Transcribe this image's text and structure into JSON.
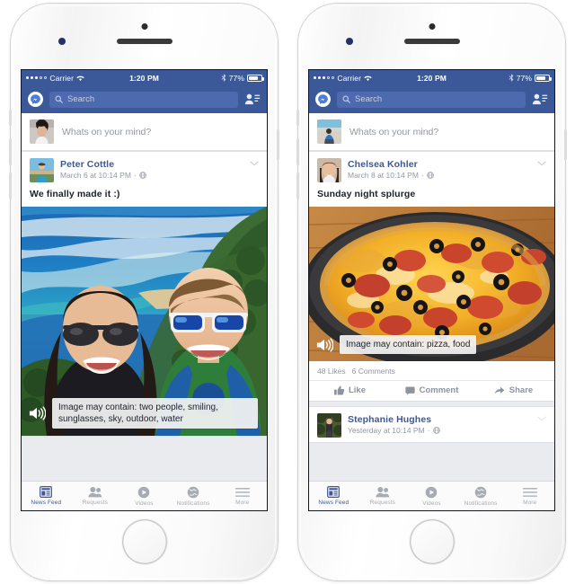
{
  "theme": {
    "brand_blue": "#3b5998",
    "search_field": "#4c6aad",
    "feed_background": "#e9ebee",
    "card_background": "#ffffff",
    "muted_text": "#9097a3",
    "body_text": "#1d2129"
  },
  "status_bar": {
    "carrier": "Carrier",
    "wifi_icon": "wifi-icon",
    "signal_icon": "signal-dots-icon",
    "time": "1:20 PM",
    "bluetooth_icon": "bluetooth-icon",
    "battery_percent": "77%",
    "battery_icon": "battery-icon",
    "battery_level": 77
  },
  "nav_bar": {
    "messenger_icon": "messenger-icon",
    "search_icon": "search-icon",
    "search_placeholder": "Search",
    "search_value": "",
    "friend_requests_icon": "friend-requests-icon"
  },
  "tab_bar": {
    "active_index": 0,
    "tabs": [
      {
        "label": "News Feed",
        "icon": "news-feed-icon"
      },
      {
        "label": "Requests",
        "icon": "friend-requests-icon"
      },
      {
        "label": "Videos",
        "icon": "video-play-icon"
      },
      {
        "label": "Notifications",
        "icon": "globe-notifications-icon"
      },
      {
        "label": "More",
        "icon": "hamburger-more-icon"
      }
    ]
  },
  "phones": [
    {
      "id": "phone-left",
      "composer": {
        "placeholder": "Whats on your mind?",
        "avatar_alt": "woman-portrait-avatar"
      },
      "posts": [
        {
          "author": "Peter Cottle",
          "timestamp": "March 6 at 10:14 PM",
          "separator": "·",
          "privacy_icon": "globe-icon",
          "menu_icon": "chevron-down-icon",
          "text": "We finally made it :)",
          "photo_alt": "coastline-selfie-photo",
          "alt_text": "Image may contain: two people, smiling, sunglasses, sky, outdoor, water",
          "speaker_icon": "speaker-icon"
        }
      ]
    },
    {
      "id": "phone-right",
      "composer": {
        "placeholder": "Whats on your mind?",
        "avatar_alt": "person-at-beach-avatar"
      },
      "posts": [
        {
          "author": "Chelsea Kohler",
          "timestamp": "March 8 at 10:14 PM",
          "separator": "·",
          "privacy_icon": "globe-icon",
          "menu_icon": "chevron-down-icon",
          "text": "Sunday night splurge",
          "photo_alt": "pepperoni-pizza-photo",
          "alt_text": "Image may contain: pizza, food",
          "speaker_icon": "speaker-icon",
          "likes": "48 Likes",
          "comments": "6 Comments",
          "actions": [
            {
              "label": "Like",
              "icon": "thumbs-up-icon"
            },
            {
              "label": "Comment",
              "icon": "comment-bubble-icon"
            },
            {
              "label": "Share",
              "icon": "share-arrow-icon"
            }
          ]
        },
        {
          "author": "Stephanie Hughes",
          "timestamp": "Yesterday at 10:14 PM",
          "separator": "·",
          "privacy_icon": "globe-icon",
          "menu_icon": "chevron-down-icon",
          "avatar_alt": "woman-in-forest-avatar"
        }
      ]
    }
  ]
}
